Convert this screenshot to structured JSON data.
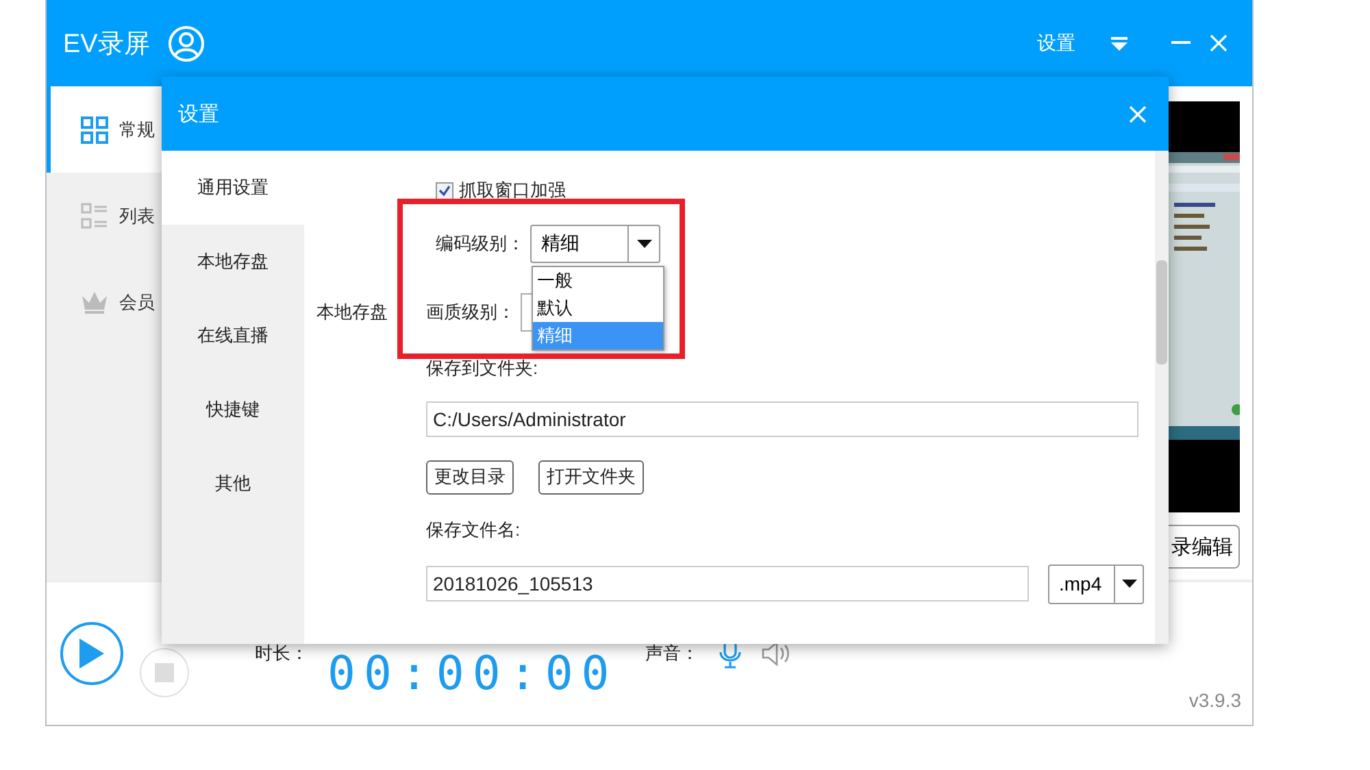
{
  "main": {
    "title": "EV录屏",
    "settings_link": "设置",
    "sidebar": [
      {
        "label": "常规",
        "selected": true
      },
      {
        "label": "列表",
        "selected": false
      },
      {
        "label": "会员",
        "selected": false
      }
    ],
    "preview_button": "录编辑",
    "duration_label": "时长：",
    "time": "00:00:00",
    "sound_label": "声音：",
    "version": "v3.9.3"
  },
  "dialog": {
    "title": "设置",
    "nav": [
      {
        "label": "通用设置",
        "selected": true
      },
      {
        "label": "本地存盘",
        "selected": false
      },
      {
        "label": "在线直播",
        "selected": false
      },
      {
        "label": "快捷键",
        "selected": false
      },
      {
        "label": "其他",
        "selected": false
      }
    ],
    "capture": {
      "label": "抓取窗口加强",
      "checked": true
    },
    "encoding": {
      "label": "编码级别：",
      "value": "精细",
      "options": [
        {
          "label": "一般",
          "selected": false
        },
        {
          "label": "默认",
          "selected": false
        },
        {
          "label": "精细",
          "selected": true
        }
      ]
    },
    "quality": {
      "label": "画质级别："
    },
    "section_label": "本地存盘",
    "folder_label": "保存到文件夹:",
    "folder_value": "C:/Users/Administrator",
    "buttons": [
      "更改目录",
      "打开文件夹"
    ],
    "filename_label": "保存文件名:",
    "filename_value": "20181026_105513",
    "extension": ".mp4"
  }
}
